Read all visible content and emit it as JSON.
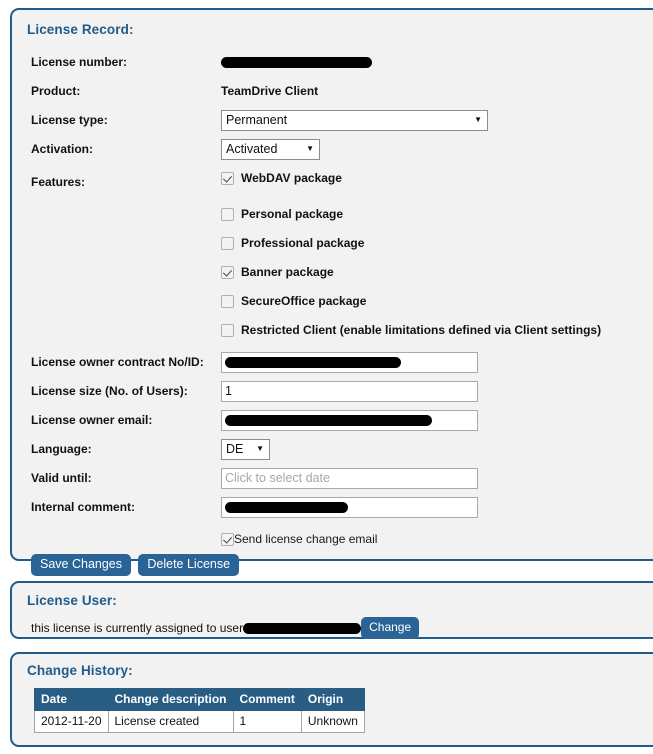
{
  "license_record": {
    "title": "License Record:",
    "labels": {
      "license_number": "License number:",
      "product": "Product:",
      "license_type": "License type:",
      "activation": "Activation:",
      "features": "Features:",
      "contract_no": "License owner contract No/ID:",
      "license_size": "License size (No. of Users):",
      "owner_email": "License owner email:",
      "language": "Language:",
      "valid_until": "Valid until:",
      "internal_comment": "Internal comment:"
    },
    "values": {
      "license_number": "",
      "product": "TeamDrive Client",
      "license_type": "Permanent",
      "activation": "Activated",
      "contract_no": "",
      "license_size": "1",
      "owner_email": "",
      "language": "DE",
      "valid_until": "",
      "valid_until_placeholder": "Click to select date",
      "internal_comment": ""
    },
    "features": [
      {
        "label": "WebDAV package",
        "checked": true
      },
      {
        "label": "Personal package",
        "checked": false
      },
      {
        "label": "Professional package",
        "checked": false
      },
      {
        "label": "Banner package",
        "checked": true
      },
      {
        "label": "SecureOffice package",
        "checked": false
      },
      {
        "label": "Restricted Client (enable limitations defined via Client settings)",
        "checked": false
      }
    ],
    "send_email": {
      "label": "Send license change email",
      "checked": true
    },
    "buttons": {
      "save": "Save Changes",
      "delete": "Delete License"
    }
  },
  "license_user": {
    "title": "License User:",
    "text": "this license is currently assigned to user",
    "change_button": "Change"
  },
  "change_history": {
    "title": "Change History:",
    "columns": [
      "Date",
      "Change description",
      "Comment",
      "Origin"
    ],
    "rows": [
      [
        "2012-11-20",
        "License created",
        "1",
        "Unknown"
      ]
    ]
  },
  "colors": {
    "panel_border": "#1f5c8b",
    "title": "#1f5c8b",
    "button": "#2a6496",
    "table_header": "#2a5d84",
    "panel_bg": "#f2f2f2"
  },
  "icons": {
    "dropdown_caret": "▼"
  }
}
